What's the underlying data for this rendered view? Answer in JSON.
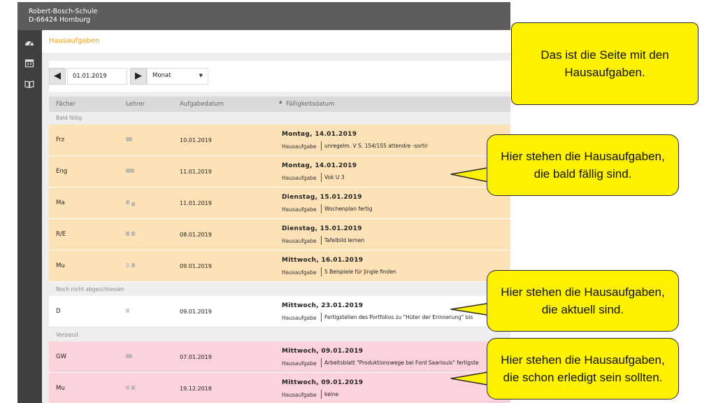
{
  "app": {
    "school_name": "Robert-Bosch-Schule",
    "school_address": "D-66424 Homburg",
    "page_title": "Hausaufgaben"
  },
  "sidebar": {
    "icons": [
      "dashboard-icon",
      "calendar-icon",
      "book-icon"
    ]
  },
  "toolbar": {
    "prev_label": "🡐",
    "next_label": "🡒",
    "date_value": "01.01.2019",
    "range_value": "Monat"
  },
  "table": {
    "headers": {
      "subject": "Fächer",
      "teacher": "Lehrer",
      "assigned": "Aufgabedatum",
      "due": "Fälligkeitsdatum"
    },
    "groups": [
      {
        "label": "Bald fällig",
        "rows": [
          {
            "subject": "Frz",
            "assigned": "10.01.2019",
            "due": "Montag, 14.01.2019",
            "kind": "Hausaufgabe",
            "desc": "unregelm. V S. 154/155 attendre -sortir"
          },
          {
            "subject": "Eng",
            "assigned": "11.01.2019",
            "due": "Montag, 14.01.2019",
            "kind": "Hausaufgabe",
            "desc": "Vok U 3"
          },
          {
            "subject": "Ma",
            "assigned": "11.01.2019",
            "due": "Dienstag, 15.01.2019",
            "kind": "Hausaufgabe",
            "desc": "Wochenplan fertig"
          },
          {
            "subject": "R/E",
            "assigned": "08.01.2019",
            "due": "Dienstag, 15.01.2019",
            "kind": "Hausaufgabe",
            "desc": "Tafelbild lernen"
          },
          {
            "subject": "Mu",
            "assigned": "09.01.2019",
            "due": "Mittwoch, 16.01.2019",
            "kind": "Hausaufgabe",
            "desc": "5 Beispiele für Jingle finden"
          }
        ]
      },
      {
        "label": "Noch nicht abgeschlossen",
        "rows": [
          {
            "subject": "D",
            "assigned": "09.01.2019",
            "due": "Mittwoch, 23.01.2019",
            "kind": "Hausaufgabe",
            "desc": "Fertigstellen des Portfolios zu \"Hüter der Erinnerung\" bis"
          }
        ]
      },
      {
        "label": "Verpasst",
        "rows": [
          {
            "subject": "GW",
            "assigned": "07.01.2019",
            "due": "Mittwoch, 09.01.2019",
            "kind": "Hausaufgabe",
            "desc": "Arbeitsblatt \"Produktionswege bei Ford Saarlouis\" fertigste"
          },
          {
            "subject": "Mu",
            "assigned": "19.12.2018",
            "due": "Mittwoch, 09.01.2019",
            "kind": "Hausaufgabe",
            "desc": "keine"
          }
        ]
      }
    ]
  },
  "callouts": [
    {
      "text": "Das ist die Seite mit den Hausaufgaben."
    },
    {
      "text": "Hier stehen die Hausaufgaben, die bald fällig sind."
    },
    {
      "text": "Hier stehen die Hausaufgaben, die aktuell sind."
    },
    {
      "text": "Hier stehen die Hausaufgaben, die schon erledigt sein sollten."
    }
  ],
  "colors": {
    "accent": "#f39a12",
    "row_soon": "#fde2b8",
    "row_open": "#ffffff",
    "row_missed": "#fcd3da",
    "callout": "#fff200"
  }
}
